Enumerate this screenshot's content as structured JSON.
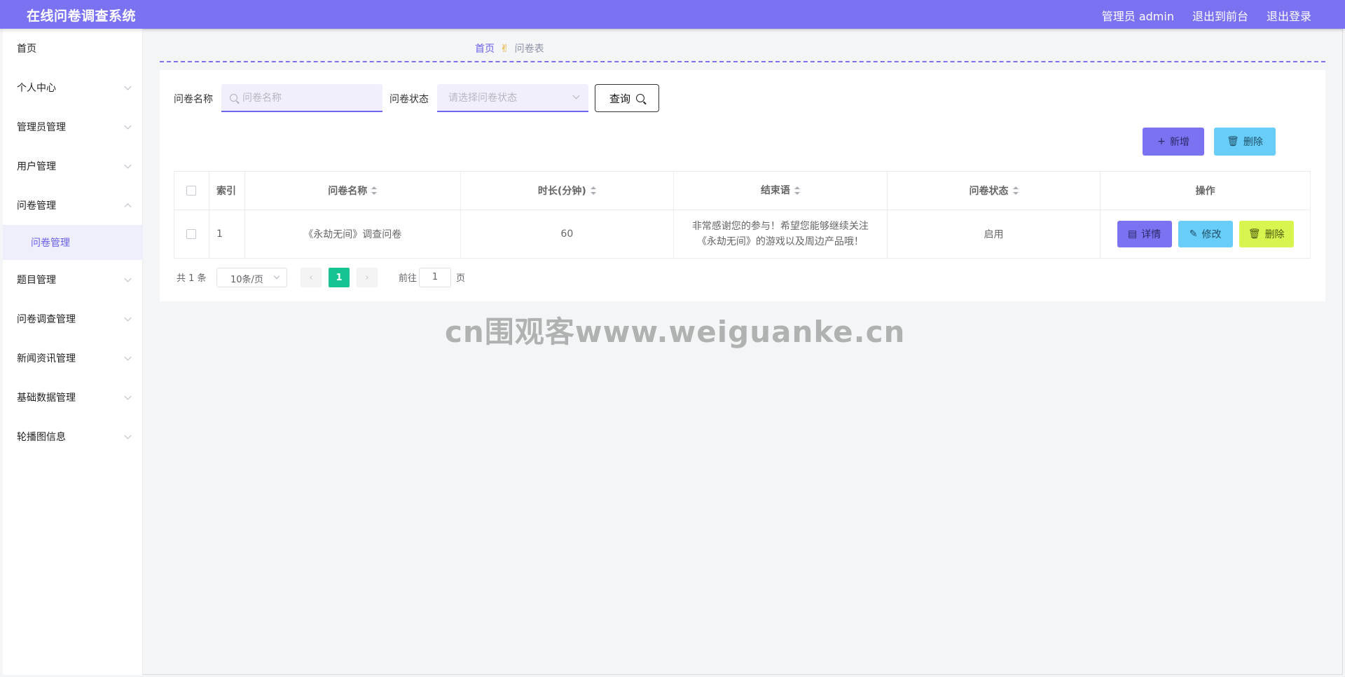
{
  "app": {
    "title": "在线问卷调查系统"
  },
  "header": {
    "user": "管理员 admin",
    "front": "退出到前台",
    "logout": "退出登录"
  },
  "sidebar": {
    "items": [
      {
        "label": "首页"
      },
      {
        "label": "个人中心"
      },
      {
        "label": "管理员管理"
      },
      {
        "label": "用户管理"
      },
      {
        "label": "问卷管理"
      },
      {
        "label": "题目管理"
      },
      {
        "label": "问卷调查管理"
      },
      {
        "label": "新闻资讯管理"
      },
      {
        "label": "基础数据管理"
      },
      {
        "label": "轮播图信息"
      }
    ],
    "active_sub": "问卷管理"
  },
  "breadcrumb": {
    "home": "首页",
    "separator": "✌",
    "current": "问卷表"
  },
  "search": {
    "name_label": "问卷名称",
    "name_placeholder": "问卷名称",
    "status_label": "问卷状态",
    "status_placeholder": "请选择问卷状态",
    "query_label": "查询"
  },
  "actions": {
    "add": "新增",
    "delete": "删除"
  },
  "table": {
    "headers": [
      "索引",
      "问卷名称",
      "时长(分钟)",
      "结束语",
      "问卷状态",
      "操作"
    ],
    "rows": [
      {
        "index": "1",
        "name": "《永劫无间》调查问卷",
        "duration": "60",
        "ending": "非常感谢您的参与！希望您能够继续关注《永劫无间》的游戏以及周边产品哦！",
        "status": "启用",
        "ops": [
          "详情",
          "修改",
          "删除"
        ]
      }
    ]
  },
  "pagination": {
    "total": "共 1 条",
    "page_size": "10条/页",
    "prev": "‹",
    "current": "1",
    "next": "›",
    "goto_label": "前往",
    "goto_value": "1",
    "page_suffix": "页"
  },
  "watermark": "cn围观客www.weiguanke.cn",
  "colors": {
    "header": "#7b72f2",
    "accent": "#6a61e8",
    "cyan": "#69cdf9",
    "lime": "#d8f44e",
    "current_page": "#16c392"
  }
}
